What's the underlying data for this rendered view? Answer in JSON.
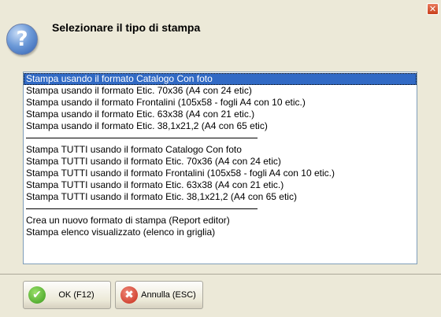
{
  "window": {
    "close_glyph": "✕"
  },
  "header": {
    "icon_glyph": "?",
    "title": "Selezionare il tipo di stampa"
  },
  "list": {
    "items": [
      {
        "type": "item",
        "label": "Stampa usando il formato Catalogo Con foto",
        "selected": true
      },
      {
        "type": "item",
        "label": "Stampa usando il formato Etic. 70x36 (A4 con 24 etic)"
      },
      {
        "type": "item",
        "label": "Stampa usando il formato Frontalini (105x58 - fogli A4 con 10 etic.)"
      },
      {
        "type": "item",
        "label": "Stampa usando il formato Etic. 63x38 (A4 con 21 etic.)"
      },
      {
        "type": "item",
        "label": "Stampa usando il formato Etic. 38,1x21,2 (A4 con 65 etic)"
      },
      {
        "type": "separator"
      },
      {
        "type": "item",
        "label": "Stampa TUTTI usando il formato Catalogo Con foto"
      },
      {
        "type": "item",
        "label": "Stampa TUTTI usando il formato Etic. 70x36 (A4 con 24 etic)"
      },
      {
        "type": "item",
        "label": "Stampa TUTTI usando il formato Frontalini (105x58 - fogli A4 con 10 etic.)"
      },
      {
        "type": "item",
        "label": "Stampa TUTTI usando il formato Etic. 63x38 (A4 con 21 etic.)"
      },
      {
        "type": "item",
        "label": "Stampa TUTTI usando il formato Etic. 38,1x21,2 (A4 con 65 etic)"
      },
      {
        "type": "separator"
      },
      {
        "type": "item",
        "label": "Crea un nuovo formato di stampa (Report editor)"
      },
      {
        "type": "item",
        "label": "Stampa elenco visualizzato (elenco in griglia)"
      }
    ]
  },
  "buttons": {
    "ok": {
      "label": "OK (F12)",
      "icon": "check-icon",
      "glyph": "✔"
    },
    "cancel": {
      "label": "Annulla (ESC)",
      "icon": "cancel-icon",
      "glyph": "✖"
    }
  },
  "colors": {
    "selection": "#316ac5",
    "dialog_bg": "#ece9d8",
    "list_border": "#7f9db9"
  }
}
